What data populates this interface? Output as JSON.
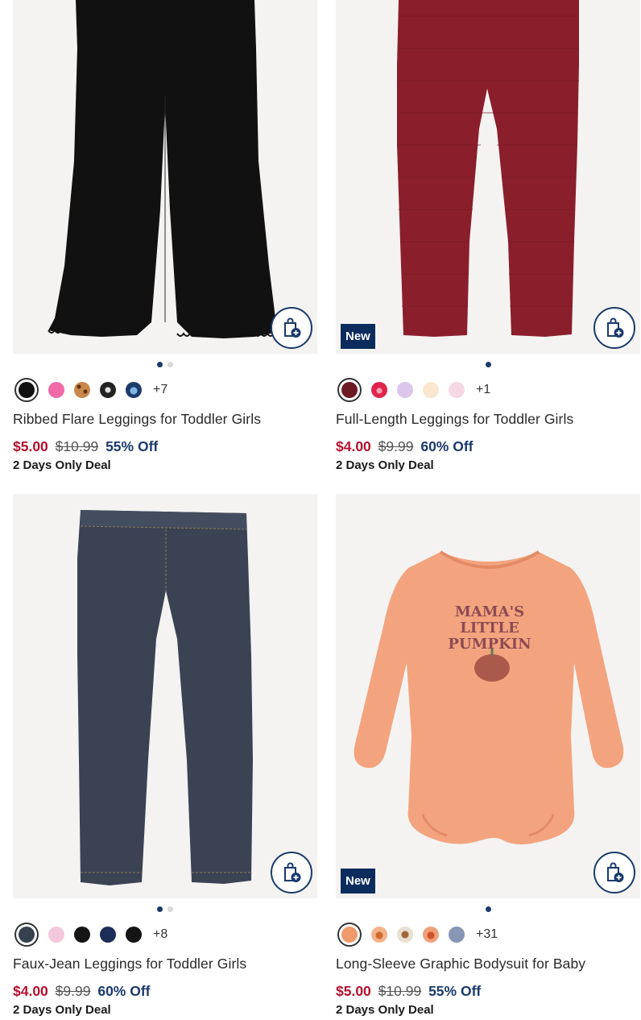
{
  "products": [
    {
      "name": "Ribbed Flare Leggings for Toddler Girls",
      "price_now": "$5.00",
      "price_was": "$10.99",
      "discount": "55% Off",
      "deal": "2 Days Only Deal",
      "more_colors": "+7",
      "badge": "",
      "swatches": [
        "#111111",
        "#f06aa8",
        "#c9874a",
        "#222222",
        "#1d3b6a"
      ],
      "image_dots": 2
    },
    {
      "name": "Full-Length Leggings for Toddler Girls",
      "price_now": "$4.00",
      "price_was": "$9.99",
      "discount": "60% Off",
      "deal": "2 Days Only Deal",
      "more_colors": "+1",
      "badge": "New",
      "swatches": [
        "#6e1a22",
        "#e0254a",
        "#dcc6ea",
        "#fbe6cf",
        "#f6d8e4"
      ],
      "image_dots": 1
    },
    {
      "name": "Faux-Jean Leggings for Toddler Girls",
      "price_now": "$4.00",
      "price_was": "$9.99",
      "discount": "60% Off",
      "deal": "2 Days Only Deal",
      "more_colors": "+8",
      "badge": "",
      "swatches": [
        "#37414f",
        "#f4c8dc",
        "#151515",
        "#1c2e57",
        "#141414"
      ],
      "image_dots": 2
    },
    {
      "name": "Long-Sleeve Graphic Bodysuit for Baby",
      "price_now": "$5.00",
      "price_was": "$10.99",
      "discount": "55% Off",
      "deal": "2 Days Only Deal",
      "more_colors": "+31",
      "badge": "New",
      "swatches": [
        "#ef9a6c",
        "#f3b38a",
        "#e9dfd2",
        "#f0a07a",
        "#8796b5"
      ],
      "image_dots": 1,
      "graphic_text": [
        "MAMA'S",
        "LITTLE",
        "PUMPKIN"
      ]
    }
  ],
  "colors": {
    "sale_red": "#b4112e",
    "navy": "#1b3a6b",
    "badge_bg": "#0b2c5c"
  }
}
